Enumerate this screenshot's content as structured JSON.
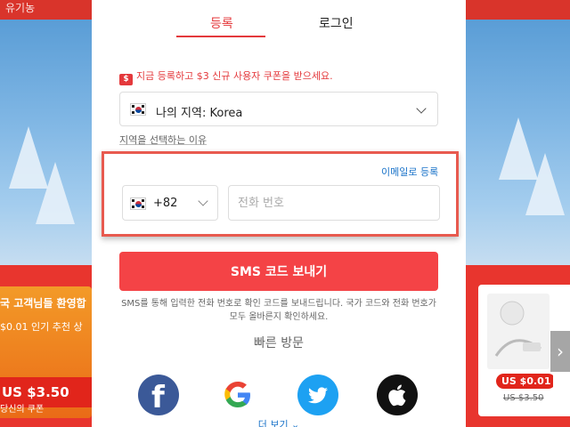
{
  "background": {
    "header_text": "유기농",
    "promo_card": {
      "line1": "국 고객님들 환영합",
      "line2": "$0.01 인기 추천 상",
      "price": "US $3.50",
      "sub": "당신의 쿠폰"
    },
    "product_card": {
      "badge": "US $0.01",
      "original_price": "US $3.50"
    }
  },
  "tabs": {
    "register": "등록",
    "login": "로그인"
  },
  "promo_text": "지금 등록하고 $3 신규 사용자 쿠폰을 받으세요.",
  "region": {
    "label": "나의 지역: Korea",
    "why_link": "지역을 선택하는 이유"
  },
  "phone": {
    "email_link": "이메일로 등록",
    "country_code": "+82",
    "placeholder": "전화 번호",
    "value": ""
  },
  "sms_button": "SMS 코드 보내기",
  "sms_note": "SMS를 통해 입력한 전화 번호로 확인 코드를 보내드립니다. 국가 코드와 전화 번호가 모두 올바른지 확인하세요.",
  "quick_title": "빠른 방문",
  "social": [
    "facebook-icon",
    "google-icon",
    "twitter-icon",
    "apple-icon"
  ],
  "more_label": "더 보기",
  "colors": {
    "accent": "#e4393c",
    "button": "#f44346",
    "link": "#1a73c9",
    "highlight_border": "#e85a4f"
  }
}
